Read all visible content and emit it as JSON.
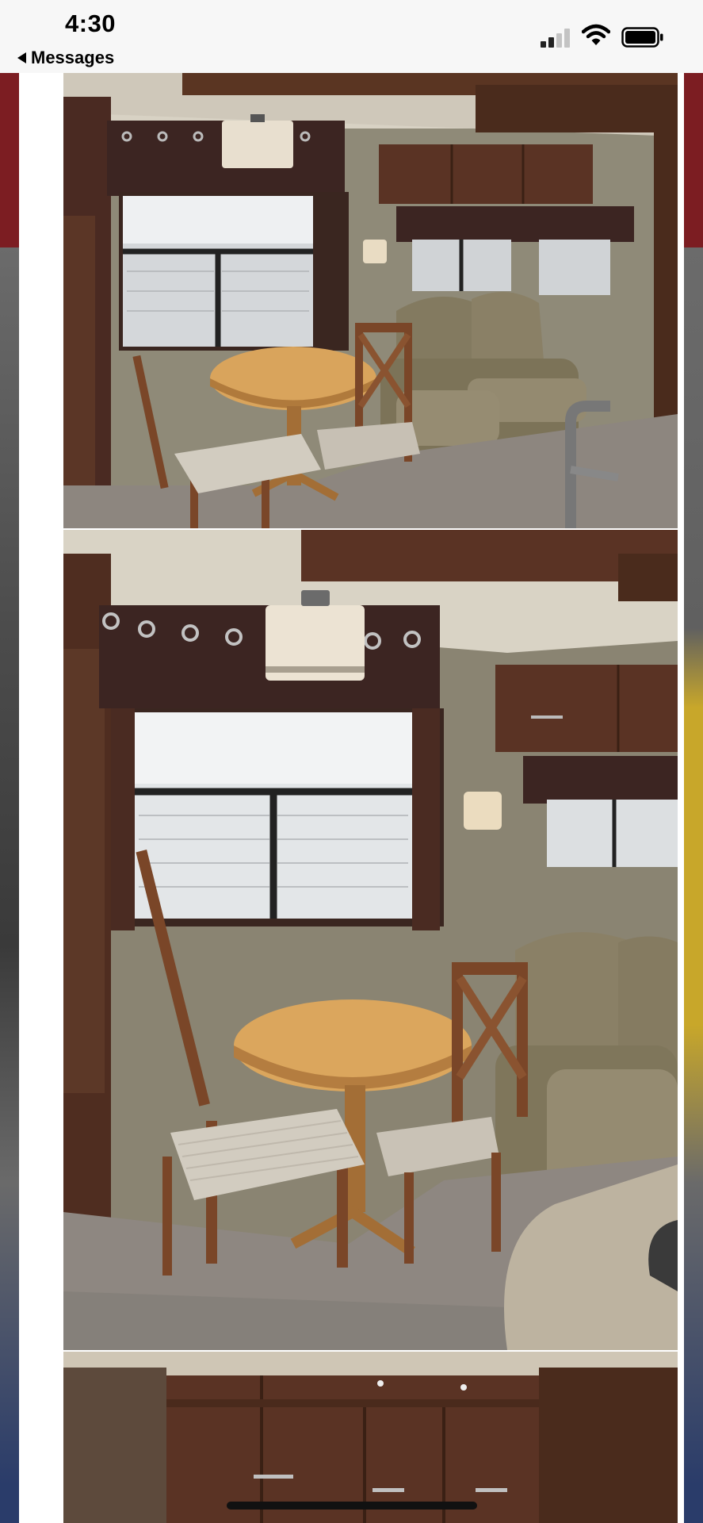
{
  "status_bar": {
    "time": "4:30",
    "signal_icon": "cellular-signal-icon",
    "wifi_icon": "wifi-icon",
    "battery_icon": "battery-icon"
  },
  "nav": {
    "back_label": "Messages",
    "back_icon": "back-arrow-icon"
  },
  "photos": [
    {
      "name": "rv-dining-area-wide"
    },
    {
      "name": "rv-dining-area-close"
    },
    {
      "name": "rv-kitchen-cabinets"
    }
  ],
  "colors": {
    "status_bg": "#f7f7f7",
    "card_bg": "#ffffff",
    "wood": "#7a4a2e",
    "recliner": "#8a7f63",
    "carpet": "#8e8781"
  }
}
